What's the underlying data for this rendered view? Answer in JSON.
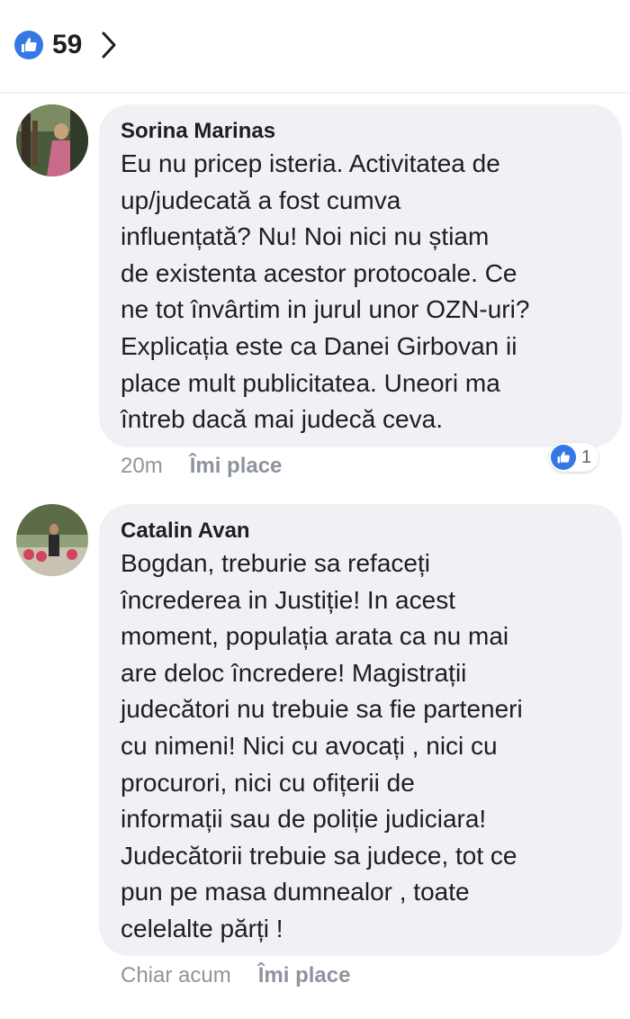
{
  "reactions": {
    "count": "59",
    "like_icon": "like-thumb-icon",
    "chevron_icon": "chevron-right-icon",
    "accent": "#3578e5"
  },
  "comments": [
    {
      "author": "Sorina Marinas",
      "text": "Eu nu pricep isteria. Activitatea de\nup/judecată a fost cumva\ninfluențată?  Nu! Noi nici nu știam\nde existenta acestor protocoale. Ce\nne tot învârtim in jurul unor OZN-uri?\nExplicația este ca Danei Girbovan ii\nplace mult publicitatea. Uneori ma\nîntreb  dacă mai judecă ceva.",
      "time": "20m",
      "like_label": "Îmi place",
      "reaction_count": "1"
    },
    {
      "author": "Catalin Avan",
      "text": "Bogdan, treburie sa refaceți\nîncrederea in Justiție! In acest\nmoment, populația arata ca nu mai\nare deloc încredere! Magistrații\njudecători nu trebuie sa fie parteneri\ncu nimeni! Nici cu avocați , nici cu\nprocurori, nici cu ofițerii de\ninformații sau de poliție judiciara!\nJudecătorii trebuie sa judece, tot ce\npun pe masa dumnealor , toate\ncelelalte părți !",
      "time": "Chiar acum",
      "like_label": "Îmi place"
    }
  ],
  "colors": {
    "bubble": "#f0f1f4",
    "meta_text": "#90949c",
    "like_blue": "#3578e5"
  }
}
